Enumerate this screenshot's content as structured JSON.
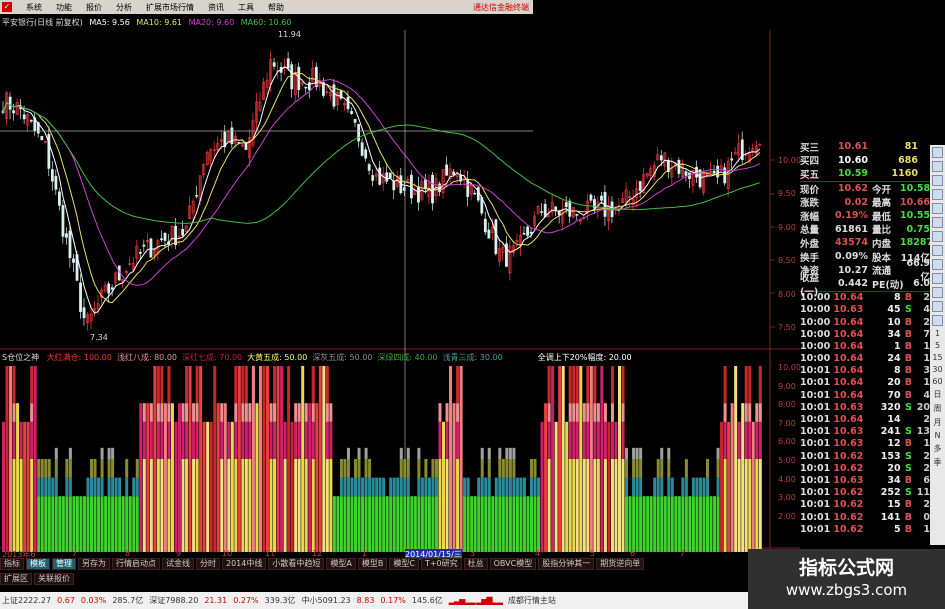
{
  "menu": {
    "items": [
      "系统",
      "功能",
      "报价",
      "分析",
      "扩展市场行情",
      "资讯",
      "工具",
      "帮助"
    ],
    "brand": "通达信金融终端"
  },
  "chart": {
    "title": "平安银行(日线 前复权)",
    "ma5": "MA5: 9.56",
    "ma10": "MA10: 9.61",
    "ma20": "MA20: 9.60",
    "ma60": "MA60: 10.60",
    "high_label": "11.94",
    "low_label": "7.34",
    "price_axis": [
      "10.00",
      "9.50",
      "9.00",
      "8.50",
      "8.00",
      "7.50"
    ],
    "colors": {
      "up": "#ff3c3c",
      "down": "#d8f0f0",
      "ma5": "#ffffff",
      "ma10": "#e8e060",
      "ma20": "#d040d0",
      "ma60": "#40c040"
    }
  },
  "indicator": {
    "name": "S仓位之神",
    "items": [
      {
        "label": "大红满仓: 100.00",
        "color": "#ff3030"
      },
      {
        "label": "浅红八成: 80.00",
        "color": "#f09090"
      },
      {
        "label": "深红七成: 70.00",
        "color": "#c02050"
      },
      {
        "label": "大黄五成: 50.00",
        "color": "#ffff60"
      },
      {
        "label": "深灰五成: 50.00",
        "color": "#909090"
      },
      {
        "label": "深绿四成: 40.00",
        "color": "#40a040"
      },
      {
        "label": "浅青三成: 30.00",
        "color": "#40a0a0"
      },
      {
        "label": "全调上下20%幅度: 20.00",
        "color": "#ffffff"
      }
    ],
    "axis": [
      "10.00",
      "9.00",
      "8.00",
      "7.00",
      "6.00",
      "5.00",
      "4.00",
      "3.00",
      "2.00"
    ]
  },
  "dates": [
    "2013年6",
    "7",
    "8",
    "9",
    "10",
    "11",
    "12",
    "1",
    "2014/01/15/三",
    "3",
    "4",
    "5",
    "6",
    "7"
  ],
  "orderbook": {
    "bids": [
      {
        "l": "买三",
        "p": "10.61",
        "v": "81"
      },
      {
        "l": "买四",
        "p": "10.60",
        "v": "686"
      },
      {
        "l": "买五",
        "p": "10.59",
        "v": "1160"
      }
    ],
    "stats": [
      [
        "现价",
        "10.62",
        "今开",
        "10.58"
      ],
      [
        "涨跌",
        "0.02",
        "最高",
        "10.66"
      ],
      [
        "涨幅",
        "0.19%",
        "最低",
        "10.55"
      ],
      [
        "总量",
        "61861",
        "量比",
        "0.75"
      ],
      [
        "外盘",
        "43574",
        "内盘",
        "18287"
      ],
      [
        "换手",
        "0.09%",
        "股本",
        "114亿"
      ],
      [
        "净资",
        "10.27",
        "流通",
        "66.9亿"
      ],
      [
        "收益(一)",
        "0.442",
        "PE(动)",
        "6.0"
      ]
    ],
    "ticks": [
      [
        "10:00",
        "10.64",
        "8",
        "B",
        "2"
      ],
      [
        "10:00",
        "10.63",
        "45",
        "S",
        "4"
      ],
      [
        "10:00",
        "10.64",
        "10",
        "B",
        "2"
      ],
      [
        "10:00",
        "10.64",
        "34",
        "B",
        "7"
      ],
      [
        "10:00",
        "10.64",
        "1",
        "B",
        "1"
      ],
      [
        "10:00",
        "10.64",
        "24",
        "B",
        "1"
      ],
      [
        "10:01",
        "10.64",
        "8",
        "B",
        "3"
      ],
      [
        "10:01",
        "10.64",
        "20",
        "B",
        "1"
      ],
      [
        "10:01",
        "10.64",
        "70",
        "B",
        "4"
      ],
      [
        "10:01",
        "10.63",
        "320",
        "S",
        "20"
      ],
      [
        "10:01",
        "10.64",
        "14",
        "",
        "2"
      ],
      [
        "10:01",
        "10.63",
        "241",
        "S",
        "13"
      ],
      [
        "10:01",
        "10.63",
        "12",
        "B",
        "1"
      ],
      [
        "10:01",
        "10.62",
        "153",
        "S",
        "2"
      ],
      [
        "10:01",
        "10.62",
        "20",
        "S",
        "2"
      ],
      [
        "10:01",
        "10.63",
        "34",
        "B",
        "6"
      ],
      [
        "10:01",
        "10.62",
        "252",
        "S",
        "11"
      ],
      [
        "10:01",
        "10.62",
        "15",
        "B",
        "2"
      ],
      [
        "10:01",
        "10.62",
        "141",
        "B",
        "0"
      ],
      [
        "10:01",
        "10.62",
        "5",
        "B",
        "1"
      ]
    ]
  },
  "toolbar": {
    "periods": [
      "1",
      "5",
      "15",
      "30",
      "60",
      "日",
      "周",
      "月",
      "N",
      "多",
      "季"
    ]
  },
  "tabs": [
    "指标",
    "模板",
    "管理",
    "另存为",
    "行情启动点",
    "试金线",
    "分时",
    "2014中线",
    "小散看中趋短",
    "模型A",
    "模型B",
    "模型C",
    "T+0研究",
    "杜总",
    "OBVC模型",
    "股指分钟其一",
    "期货逆向单"
  ],
  "tabs2": [
    "扩展区",
    "关联报价"
  ],
  "status": {
    "sh": "上证2222.27",
    "sh_chg": "0.67",
    "sh_pct": "0.03%",
    "sh_amt": "285.7亿",
    "sz": "深证7988.20",
    "sz_chg": "21.31",
    "sz_pct": "0.27%",
    "sz_amt": "339.3亿",
    "zx": "中小5091.23",
    "zx_chg": "8.83",
    "zx_pct": "0.17%",
    "zx_amt": "145.6亿",
    "server": "成都行情主站"
  },
  "watermark": {
    "name": "指标公式网",
    "url": "www.zbgs3.com"
  }
}
